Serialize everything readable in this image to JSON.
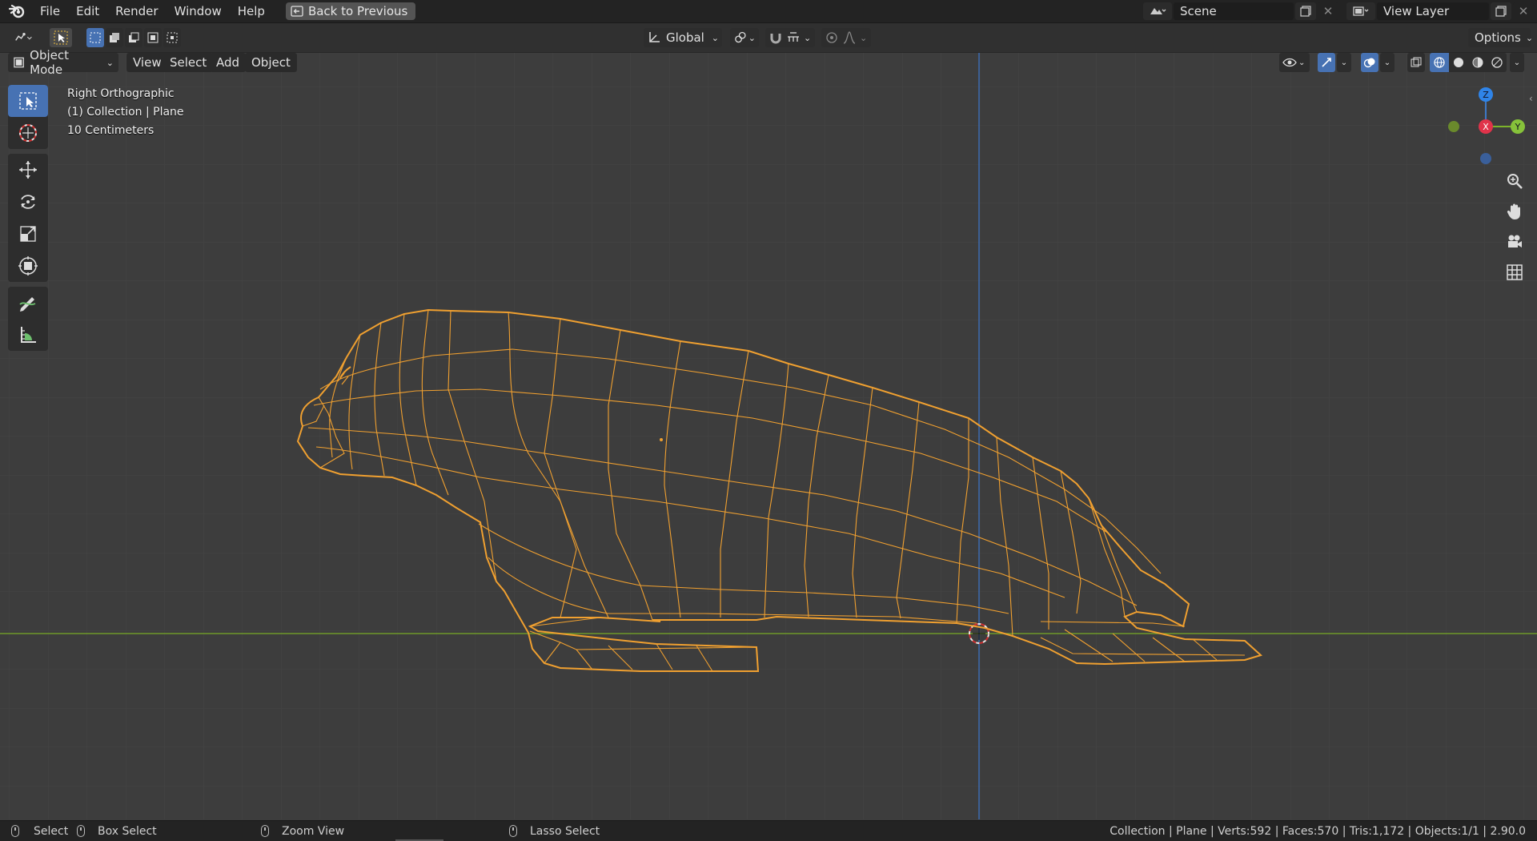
{
  "menu": {
    "items": [
      "File",
      "Edit",
      "Render",
      "Window",
      "Help"
    ],
    "back_button": "Back to Previous"
  },
  "scene": {
    "name": "Scene"
  },
  "view_layer": {
    "name": "View Layer"
  },
  "toolbar": {
    "transform_orientation": "Global",
    "options_label": "Options"
  },
  "viewport_header": {
    "mode": "Object Mode",
    "menus": [
      "View",
      "Select",
      "Add",
      "Object"
    ]
  },
  "overlay": {
    "view_name": "Right Orthographic",
    "collection": "(1) Collection | Plane",
    "scale": "10 Centimeters"
  },
  "gizmo": {
    "z": "Z",
    "x": "X",
    "y": "Y"
  },
  "tools": [
    "select-box",
    "cursor",
    "move",
    "rotate",
    "scale",
    "transform",
    "annotate",
    "measure"
  ],
  "statusbar": {
    "select": "Select",
    "box_select": "Box Select",
    "zoom_view": "Zoom View",
    "lasso_select": "Lasso Select",
    "stats": "Collection | Plane | Verts:592 | Faces:570 | Tris:1,172 | Objects:1/1 | 2.90.0"
  },
  "colors": {
    "background": "#3d3d3d",
    "wire": "#f0a030",
    "x_axis": "#8cb33a",
    "z_axis": "#3d78c6",
    "accent": "#4772b3"
  }
}
